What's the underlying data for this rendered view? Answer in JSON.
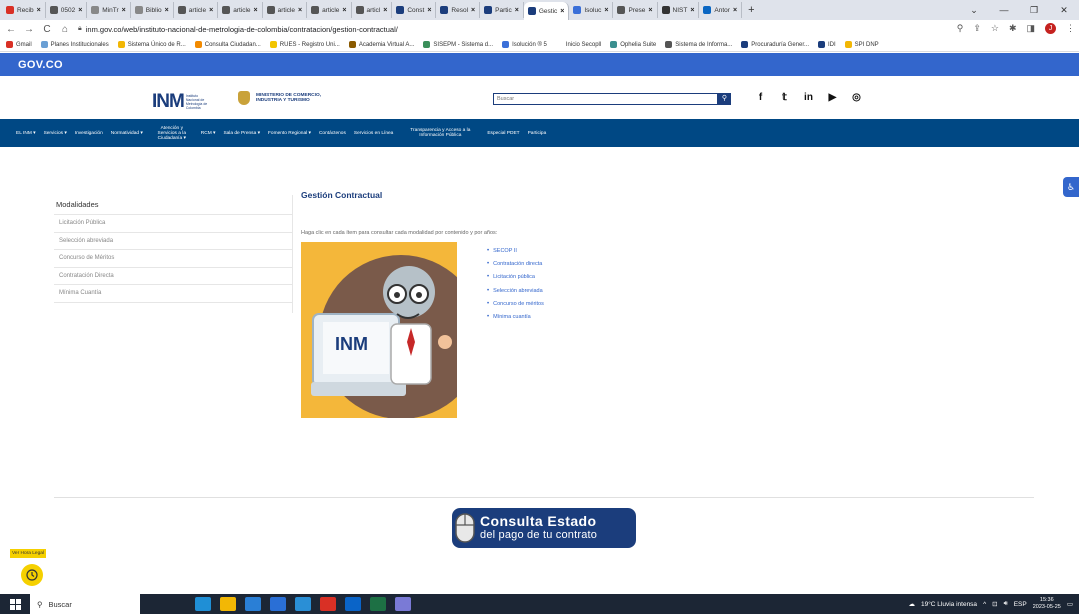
{
  "browser": {
    "tabs": [
      {
        "label": "Recib",
        "favicon": "gmail-icon",
        "color": "#d93025"
      },
      {
        "label": "0502",
        "favicon": "globe-icon",
        "color": "#555555"
      },
      {
        "label": "MinTr",
        "favicon": "page-icon",
        "color": "#888888"
      },
      {
        "label": "Biblio",
        "favicon": "page-icon",
        "color": "#888888"
      },
      {
        "label": "article",
        "favicon": "globe-icon",
        "color": "#555555"
      },
      {
        "label": "article",
        "favicon": "globe-icon",
        "color": "#555555"
      },
      {
        "label": "article",
        "favicon": "globe-icon",
        "color": "#555555"
      },
      {
        "label": "article",
        "favicon": "globe-icon",
        "color": "#555555"
      },
      {
        "label": "articl",
        "favicon": "globe-icon",
        "color": "#555555"
      },
      {
        "label": "Const",
        "favicon": "inm-icon",
        "color": "#1b3d7c"
      },
      {
        "label": "Resol",
        "favicon": "inm-icon",
        "color": "#1b3d7c"
      },
      {
        "label": "Partic",
        "favicon": "inm-icon",
        "color": "#1b3d7c"
      },
      {
        "label": "Gestic",
        "favicon": "inm-icon",
        "color": "#1b3d7c",
        "active": true
      },
      {
        "label": "Isoluc",
        "favicon": "isolucion-icon",
        "color": "#3a6fd8"
      },
      {
        "label": "Prese",
        "favicon": "globe-icon",
        "color": "#555555"
      },
      {
        "label": "NIST",
        "favicon": "nist-icon",
        "color": "#333333"
      },
      {
        "label": "Antor",
        "favicon": "linkedin-icon",
        "color": "#0a66c2"
      }
    ],
    "new_tab": "+",
    "url": "inm.gov.co/web/instituto-nacional-de-metrologia-de-colombia/contratacion/gestion-contractual/",
    "bookmarks": [
      {
        "label": "Gmail",
        "color": "#d93025"
      },
      {
        "label": "Planes Institucionales",
        "color": "#6a9fd4"
      },
      {
        "label": "Sistema Único de R...",
        "color": "#f2b705"
      },
      {
        "label": "Consulta Ciudadan...",
        "color": "#f28a00"
      },
      {
        "label": "RUES - Registro Uni...",
        "color": "#f2c500"
      },
      {
        "label": "Academia Virtual A...",
        "color": "#8a5a00"
      },
      {
        "label": "SISEPM - Sistema d...",
        "color": "#3a8f5a"
      },
      {
        "label": "Isolución ® 5",
        "color": "#3a6fd8"
      },
      {
        "label": "Inicio Secopll",
        "color": "#ffffff"
      },
      {
        "label": "Ophelia Suite",
        "color": "#3a8f8f"
      },
      {
        "label": "Sistema de Informa...",
        "color": "#555555"
      },
      {
        "label": "Procuraduría Gener...",
        "color": "#1b3d7c"
      },
      {
        "label": "IDI",
        "color": "#1b3d7c"
      },
      {
        "label": "SPI DNP",
        "color": "#f2b705"
      }
    ]
  },
  "page": {
    "govco_label": "GOV.CO",
    "inm_mark": "INM",
    "inm_text": "Instituto Nacional de Metrología de Colombia",
    "ministry_text": "MINISTERIO DE COMERCIO, INDUSTRIA Y TURISMO",
    "search_placeholder": "Buscar",
    "social": [
      "facebook-icon",
      "twitter-icon",
      "linkedin-icon",
      "youtube-icon",
      "instagram-icon"
    ],
    "nav": [
      {
        "label": "EL INM ▾",
        "kind": "one"
      },
      {
        "label": "Servicios ▾",
        "kind": "one"
      },
      {
        "label": "Investigación",
        "kind": "one"
      },
      {
        "label": "Normatividad ▾",
        "kind": "one"
      },
      {
        "label": "Atención y Servicios a la Ciudadanía ▾",
        "kind": "two"
      },
      {
        "label": "RCM ▾",
        "kind": "one"
      },
      {
        "label": "Sala de Prensa ▾",
        "kind": "one"
      },
      {
        "label": "Fomento Regional ▾",
        "kind": "one"
      },
      {
        "label": "Contáctenos",
        "kind": "one"
      },
      {
        "label": "Servicios en Línea",
        "kind": "one"
      },
      {
        "label": "Transparencia y Acceso a la Información Pública",
        "kind": "three"
      },
      {
        "label": "Especial PDET",
        "kind": "one"
      },
      {
        "label": "Participa",
        "kind": "one"
      }
    ],
    "sidebar_title": "Modalidades",
    "sidebar_items": [
      "Licitación Pública",
      "Selección abreviada",
      "Concurso de Méritos",
      "Contratación Directa",
      "Mínima Cuantía"
    ],
    "content_title": "Gestión Contractual",
    "content_intro": "Haga clic en cada ítem para consultar cada modalidad por contenido y por años:",
    "links": [
      "SECOP II",
      "Contratación directa",
      "Licitación pública",
      "Selección abreviada",
      "Concurso de méritos",
      "Mínima cuantía"
    ],
    "consulta_title": "Consulta Estado",
    "consulta_sub": "del pago de tu contrato",
    "hora_legal": "Ver Hora Legal"
  },
  "taskbar": {
    "search_label": "Buscar",
    "apps": [
      {
        "name": "task-view-icon",
        "color": "#1c2635"
      },
      {
        "name": "edge-icon",
        "color": "#1f8fd6"
      },
      {
        "name": "file-explorer-icon",
        "color": "#f2b705"
      },
      {
        "name": "store-icon",
        "color": "#2a7fd6"
      },
      {
        "name": "mail-icon",
        "color": "#2a6fd6"
      },
      {
        "name": "ie-icon",
        "color": "#2a8fd6"
      },
      {
        "name": "chrome-icon",
        "color": "#d93025"
      },
      {
        "name": "outlook-icon",
        "color": "#0a64c8"
      },
      {
        "name": "excel-icon",
        "color": "#1d7044"
      },
      {
        "name": "paint-icon",
        "color": "#7a7ad6"
      }
    ],
    "weather": "19°C  Lluvia intensa",
    "lang": "ESP",
    "time": "15:36",
    "date": "2023-05-25"
  }
}
